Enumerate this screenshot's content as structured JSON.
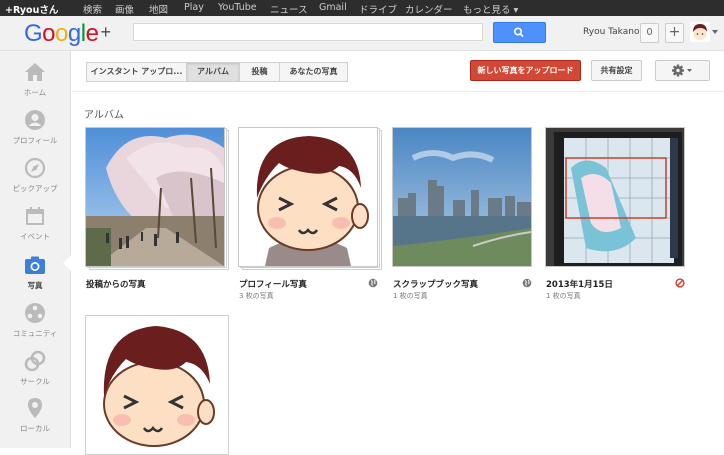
{
  "topbar": {
    "items": [
      "+Ryouさん",
      "検索",
      "画像",
      "地図",
      "Play",
      "YouTube",
      "ニュース",
      "Gmail",
      "ドライブ",
      "カレンダー",
      "もっと見る"
    ],
    "more_arrow": "▾"
  },
  "header": {
    "logo": [
      "G",
      "o",
      "o",
      "g",
      "l",
      "e"
    ],
    "logo_plus": "+",
    "search_placeholder": "",
    "user_name": "Ryou Takano",
    "notification_count": "0",
    "share_plus": "+"
  },
  "sidebar": {
    "items": [
      {
        "label": "ホーム",
        "icon": "home-icon"
      },
      {
        "label": "プロフィール",
        "icon": "profile-icon"
      },
      {
        "label": "ピックアップ",
        "icon": "explore-icon"
      },
      {
        "label": "イベント",
        "icon": "events-icon"
      },
      {
        "label": "写真",
        "icon": "camera-icon",
        "active": true
      },
      {
        "label": "コミュニティ",
        "icon": "communities-icon"
      },
      {
        "label": "サークル",
        "icon": "circles-icon"
      },
      {
        "label": "ローカル",
        "icon": "local-icon"
      }
    ]
  },
  "toolbar": {
    "tabs": [
      "インスタント アップロ...",
      "アルバム",
      "投稿",
      "あなたの写真"
    ],
    "selected_tab": "アルバム",
    "upload_label": "新しい写真をアップロード",
    "share_settings_label": "共有設定"
  },
  "main": {
    "section_title": "アルバム",
    "albums": [
      {
        "title": "投稿からの写真",
        "count": "",
        "visibility_icon": ""
      },
      {
        "title": "プロフィール写真",
        "count": "3 枚の写真",
        "visibility_icon": "globe-icon"
      },
      {
        "title": "スクラップブック写真",
        "count": "1 枚の写真",
        "visibility_icon": "globe-icon"
      },
      {
        "title": "2013年1月15日",
        "count": "1 枚の写真",
        "visibility_icon": "blocked-icon"
      }
    ]
  },
  "colors": {
    "google_blue": "#3369e8",
    "google_red": "#d50f25",
    "google_yellow": "#eeb211",
    "google_green": "#009925",
    "upload_red": "#d14836",
    "search_blue": "#4d90fe"
  }
}
